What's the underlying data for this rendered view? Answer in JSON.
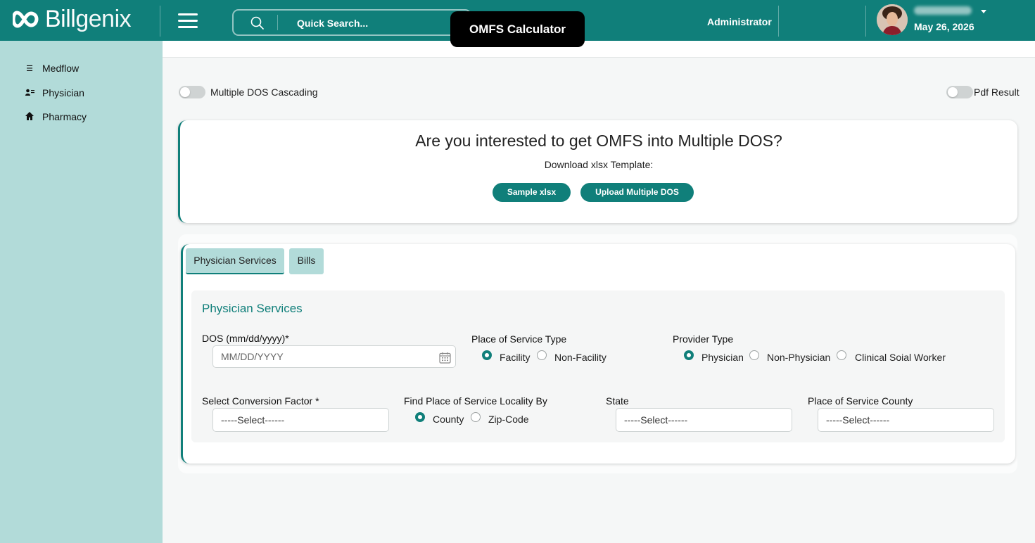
{
  "header": {
    "logo_text_bold": "Bill",
    "logo_text_light": "genix",
    "search_placeholder": "Quick Search...",
    "page_badge": "OMFS Calculator",
    "role": "Administrator",
    "date": "May 26, 2026",
    "colors": {
      "primary": "#107f7a",
      "sidebar": "#b2dbd9"
    }
  },
  "sidebar": {
    "items": [
      {
        "label": "Medflow",
        "icon": "list-icon"
      },
      {
        "label": "Physician",
        "icon": "physician-icon"
      },
      {
        "label": "Pharmacy",
        "icon": "home-icon"
      }
    ]
  },
  "toggles": {
    "multiple_dos": {
      "label": "Multiple DOS Cascading",
      "on": false
    },
    "pdf_result": {
      "label": "Pdf Result",
      "on": false
    }
  },
  "multi_dos_card": {
    "title": "Are you interested to get OMFS into Multiple DOS?",
    "subtitle": "Download xlsx Template:",
    "sample_button": "Sample xlsx",
    "upload_button": "Upload Multiple DOS"
  },
  "tabs": [
    {
      "label": "Physician Services",
      "active": true
    },
    {
      "label": "Bills",
      "active": false
    }
  ],
  "form": {
    "title": "Physician Services",
    "dos": {
      "label": "DOS (mm/dd/yyyy)*",
      "placeholder": "MM/DD/YYYY"
    },
    "place_of_service_type": {
      "label": "Place of Service Type",
      "options": [
        "Facility",
        "Non-Facility"
      ],
      "selected": "Facility"
    },
    "provider_type": {
      "label": "Provider Type",
      "options": [
        "Physician",
        "Non-Physician",
        "Clinical Soial Worker"
      ],
      "selected": "Physician"
    },
    "conversion_factor": {
      "label": "Select Conversion Factor *",
      "value": "-----Select------"
    },
    "locality_by": {
      "label": "Find Place of Service Locality By",
      "options": [
        "County",
        "Zip-Code"
      ],
      "selected": "County"
    },
    "state": {
      "label": "State",
      "value": "-----Select------"
    },
    "county": {
      "label": "Place of Service County",
      "value": "-----Select------"
    }
  }
}
